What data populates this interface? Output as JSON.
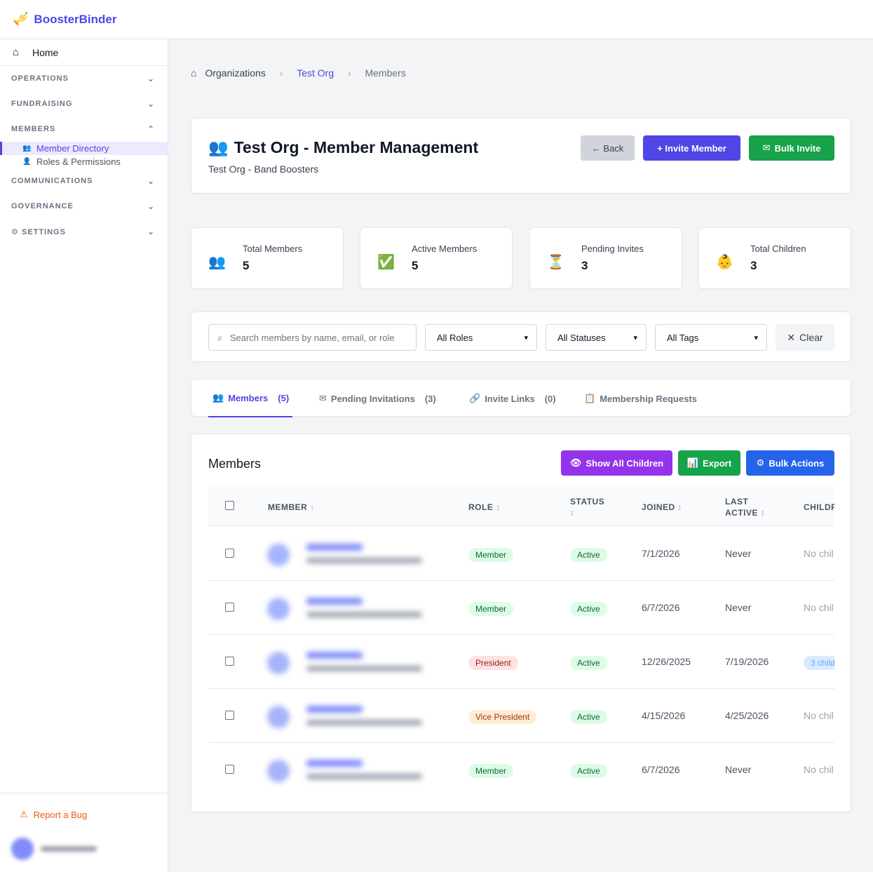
{
  "app": {
    "name": "BoosterBinder"
  },
  "sidebar": {
    "home": "Home",
    "sections": [
      {
        "label": "OPERATIONS"
      },
      {
        "label": "FUNDRAISING"
      },
      {
        "label": "MEMBERS"
      },
      {
        "label": "COMMUNICATIONS"
      },
      {
        "label": "GOVERNANCE"
      },
      {
        "label": "SETTINGS"
      }
    ],
    "members_sub": [
      "Member Directory",
      "Roles & Permissions"
    ],
    "report_bug": "Report a Bug"
  },
  "breadcrumb": {
    "root": "Organizations",
    "org": "Test Org",
    "current": "Members"
  },
  "header": {
    "title": "Test Org - Member Management",
    "subtitle": "Test Org - Band Boosters",
    "back": "← Back",
    "invite": "+ Invite Member",
    "bulk_invite": "Bulk Invite"
  },
  "stats": [
    {
      "label": "Total Members",
      "value": "5"
    },
    {
      "label": "Active Members",
      "value": "5"
    },
    {
      "label": "Pending Invites",
      "value": "3"
    },
    {
      "label": "Total Children",
      "value": "3"
    }
  ],
  "filters": {
    "search_placeholder": "Search members by name, email, or role",
    "roles": "All Roles",
    "statuses": "All Statuses",
    "tags": "All Tags",
    "clear": "Clear"
  },
  "tabs": [
    {
      "label": "Members",
      "count": "(5)"
    },
    {
      "label": "Pending Invitations",
      "count": "(3)"
    },
    {
      "label": "Invite Links",
      "count": "(0)"
    },
    {
      "label": "Membership Requests",
      "count": ""
    }
  ],
  "table": {
    "title": "Members",
    "show_children": "Show All Children",
    "export": "Export",
    "bulk_actions": "Bulk Actions",
    "headers": {
      "member": "MEMBER",
      "role": "ROLE",
      "status": "STATUS",
      "joined": "JOINED",
      "last_active_1": "LAST",
      "last_active_2": "ACTIVE",
      "children": "CHILDR"
    },
    "rows": [
      {
        "role": "Member",
        "status": "Active",
        "joined": "7/1/2026",
        "last_active": "Never",
        "children": "No chil"
      },
      {
        "role": "Member",
        "status": "Active",
        "joined": "6/7/2026",
        "last_active": "Never",
        "children": "No chil"
      },
      {
        "role": "President",
        "status": "Active",
        "joined": "12/26/2025",
        "last_active": "7/19/2026",
        "children": "3 child"
      },
      {
        "role": "Vice President",
        "status": "Active",
        "joined": "4/15/2026",
        "last_active": "4/25/2026",
        "children": "No chil"
      },
      {
        "role": "Member",
        "status": "Active",
        "joined": "6/7/2026",
        "last_active": "Never",
        "children": "No chil"
      }
    ]
  }
}
